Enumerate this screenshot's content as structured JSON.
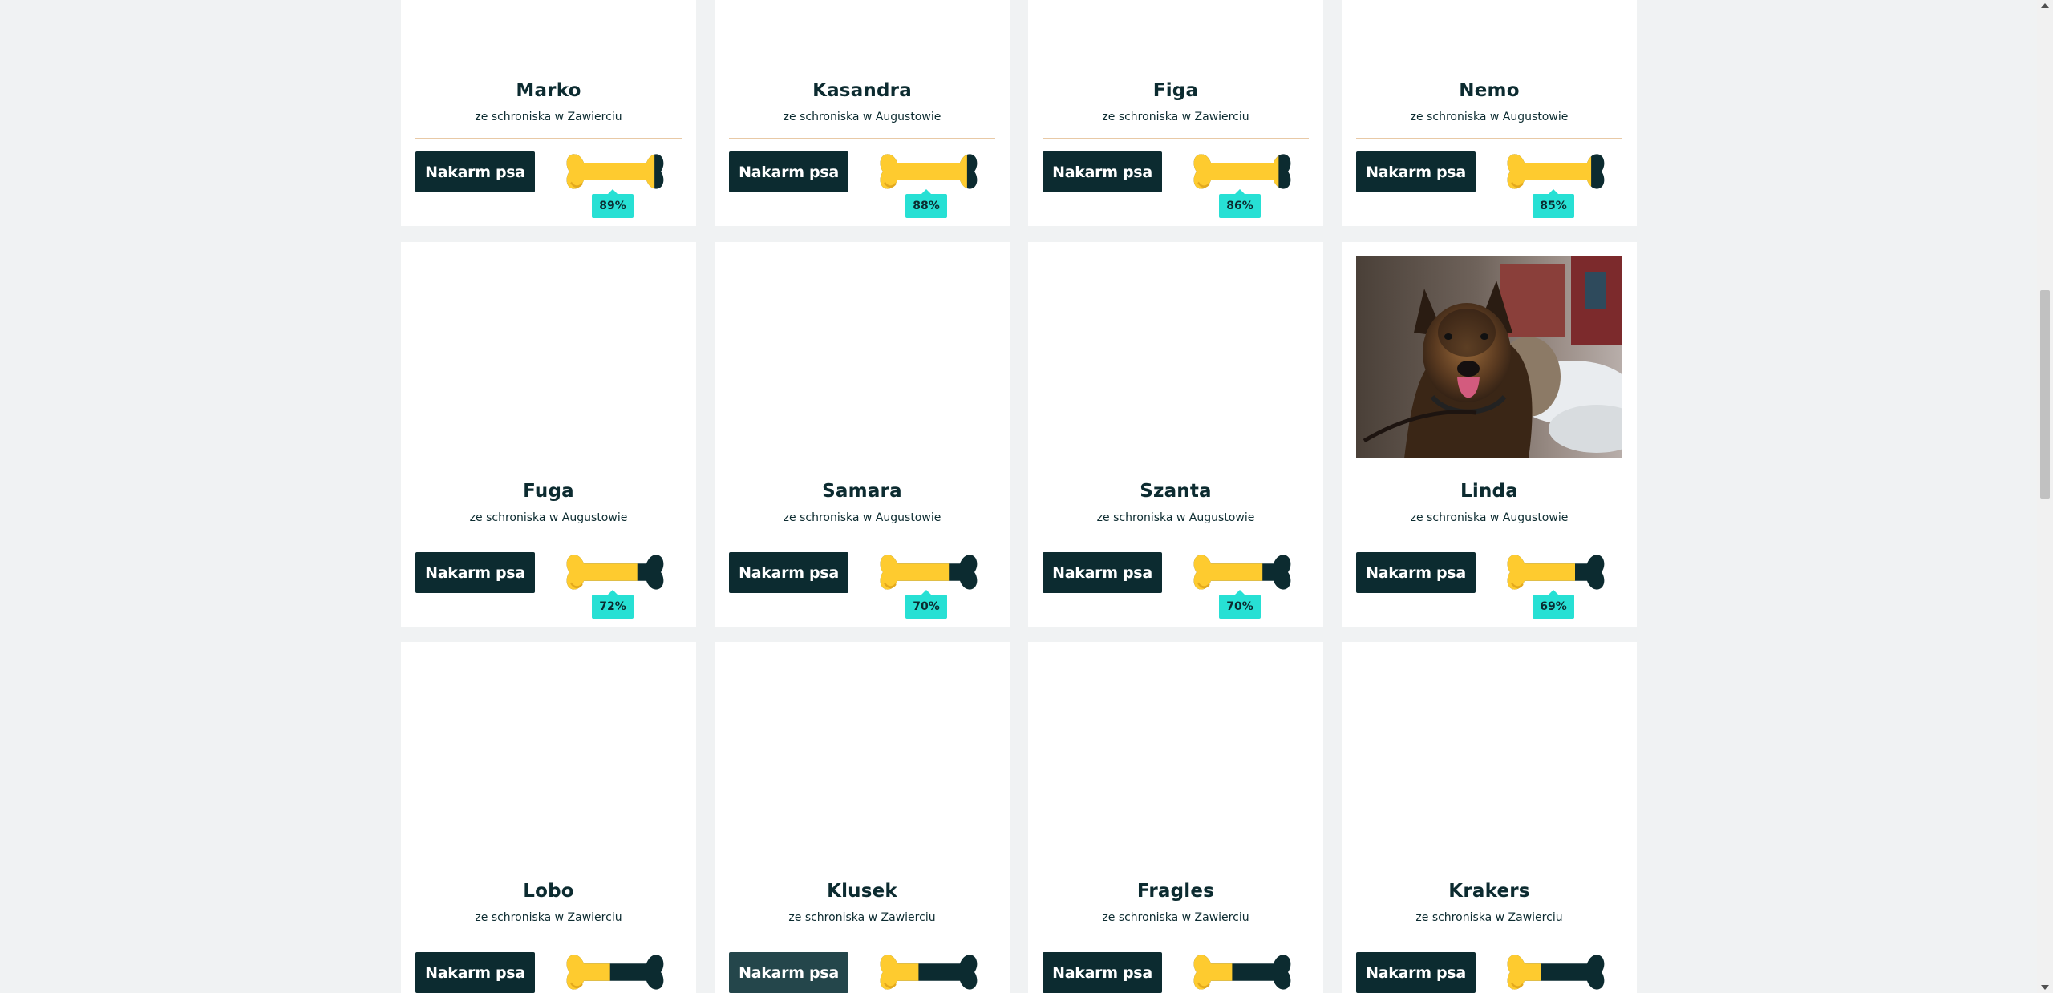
{
  "colors": {
    "page_background": "#f0f2f3",
    "card_background": "#ffffff",
    "primary_dark": "#0c2b30",
    "bone_yellow": "#fecb2f",
    "percent_badge": "#27e0d4",
    "divider": "#e8c9a6"
  },
  "feed_label": "Nakarm psa",
  "icons": {
    "bone": "bone-meter-icon",
    "photo": "dog-photo"
  },
  "dogs": [
    {
      "name": "Marko",
      "shelter": "ze schroniska w Zawierciu",
      "fed_percent": "89%",
      "fed": 0.89
    },
    {
      "name": "Kasandra",
      "shelter": "ze schroniska w Augustowie",
      "fed_percent": "88%",
      "fed": 0.88
    },
    {
      "name": "Figa",
      "shelter": "ze schroniska w Zawierciu",
      "fed_percent": "86%",
      "fed": 0.86
    },
    {
      "name": "Nemo",
      "shelter": "ze schroniska w Augustowie",
      "fed_percent": "85%",
      "fed": 0.85
    },
    {
      "name": "Fuga",
      "shelter": "ze schroniska w Augustowie",
      "fed_percent": "72%",
      "fed": 0.72
    },
    {
      "name": "Samara",
      "shelter": "ze schroniska w Augustowie",
      "fed_percent": "70%",
      "fed": 0.7
    },
    {
      "name": "Szanta",
      "shelter": "ze schroniska w Augustowie",
      "fed_percent": "70%",
      "fed": 0.7
    },
    {
      "name": "Linda",
      "shelter": "ze schroniska w Augustowie",
      "fed_percent": "69%",
      "fed": 0.69,
      "has_photo": true
    },
    {
      "name": "Lobo",
      "shelter": "ze schroniska w Zawierciu",
      "fed_percent": "",
      "fed": 0.45
    },
    {
      "name": "Klusek",
      "shelter": "ze schroniska w Zawierciu",
      "fed_percent": "",
      "fed": 0.4
    },
    {
      "name": "Fragles",
      "shelter": "ze schroniska w Zawierciu",
      "fed_percent": "",
      "fed": 0.4
    },
    {
      "name": "Krakers",
      "shelter": "ze schroniska w Zawierciu",
      "fed_percent": "",
      "fed": 0.35
    }
  ]
}
